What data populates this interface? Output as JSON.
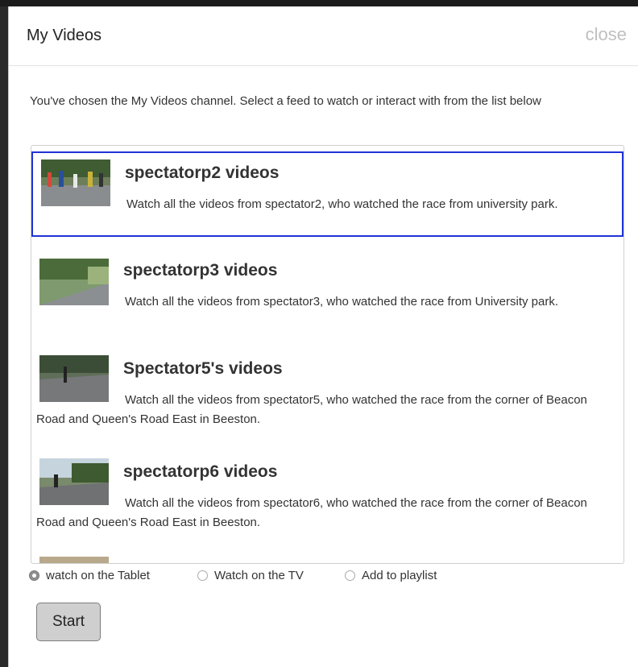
{
  "dialog": {
    "title": "My Videos",
    "close_label": "close",
    "intro": "You've chosen the My Videos channel. Select a feed to watch or interact with from the list below"
  },
  "feeds": [
    {
      "title": "spectatorp2 videos",
      "description": "Watch all the videos from spectator2, who watched the race from university park.",
      "selected": true
    },
    {
      "title": "spectatorp3 videos",
      "description": "Watch all the videos from spectator3, who watched the race from University park.",
      "selected": false
    },
    {
      "title": "Spectator5's videos",
      "description": "Watch all the videos from spectator5, who watched the race from the corner of Beacon Road and Queen's Road East in Beeston.",
      "selected": false
    },
    {
      "title": "spectatorp6 videos",
      "description": "Watch all the videos from spectator6, who watched the race from the corner of Beacon Road and Queen's Road East in Beeston.",
      "selected": false
    }
  ],
  "options": [
    {
      "label": "watch on the Tablet",
      "checked": true
    },
    {
      "label": "Watch on the TV",
      "checked": false
    },
    {
      "label": "Add to playlist",
      "checked": false
    }
  ],
  "start_label": "Start",
  "colors": {
    "selection_border": "#2033d6",
    "close_text": "#bfbfbf"
  }
}
